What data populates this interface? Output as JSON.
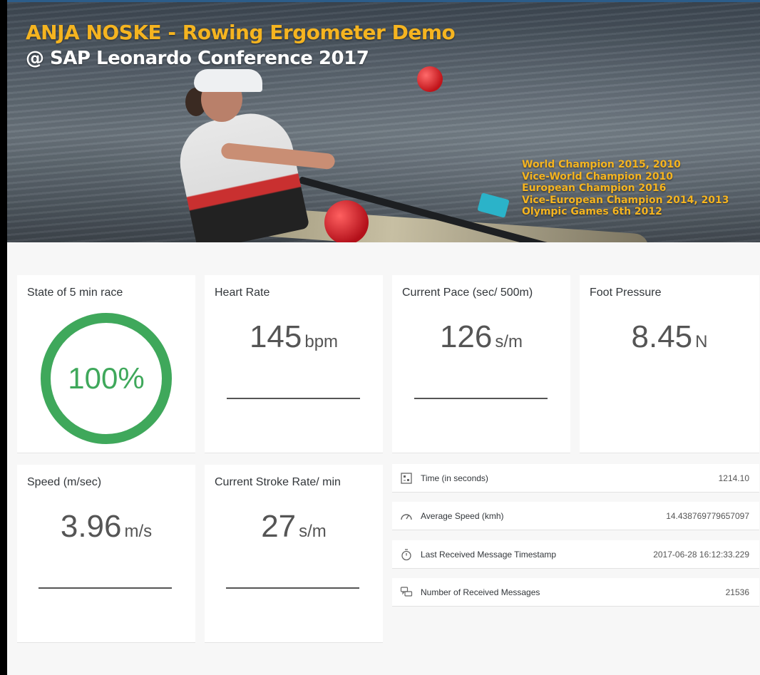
{
  "header": {
    "title": "ANJA NOSKE - Rowing Ergometer Demo",
    "subtitle": "@ SAP Leonardo Conference 2017",
    "achievements": [
      "World Champion 2015, 2010",
      "Vice-World Champion 2010",
      "European Champion 2016",
      "Vice-European Champion 2014, 2013",
      "Olympic Games 6th 2012"
    ]
  },
  "colors": {
    "accent_title": "#f5b420",
    "progress_ring": "#3fa85b",
    "frame_top": "#2c5d8a"
  },
  "tiles": {
    "race": {
      "label": "State of 5 min race",
      "value": "100%",
      "progress": 1.0
    },
    "heart": {
      "label": "Heart Rate",
      "value": "145",
      "unit": "bpm"
    },
    "pace": {
      "label": "Current Pace (sec/ 500m)",
      "value": "126",
      "unit": "s/m"
    },
    "foot": {
      "label": "Foot Pressure",
      "value": "8.45",
      "unit": "N"
    },
    "speed": {
      "label": "Speed (m/sec)",
      "value": "3.96",
      "unit": "m/s"
    },
    "stroke": {
      "label": "Current Stroke Rate/ min",
      "value": "27",
      "unit": "s/m"
    }
  },
  "list": [
    {
      "icon": "timer-grid-icon",
      "label": "Time (in seconds)",
      "value": "1214.10"
    },
    {
      "icon": "speedometer-icon",
      "label": "Average Speed (kmh)",
      "value": "14.438769779657097"
    },
    {
      "icon": "stopwatch-icon",
      "label": "Last Received Message Timestamp",
      "value": "2017-06-28 16:12:33.229"
    },
    {
      "icon": "chat-bubbles-icon",
      "label": "Number of Received Messages",
      "value": "21536"
    }
  ]
}
